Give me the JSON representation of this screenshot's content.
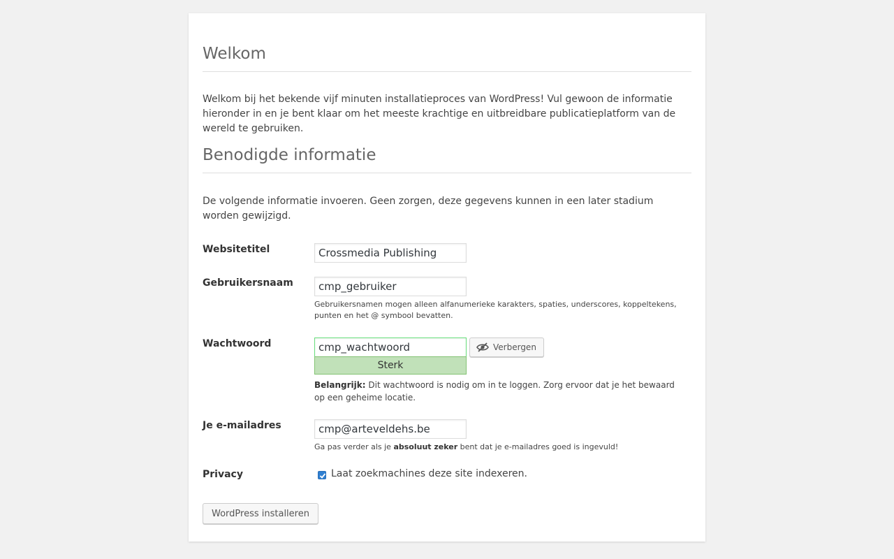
{
  "welcome": {
    "heading": "Welkom",
    "text": "Welkom bij het bekende vijf minuten installatieproces van WordPress! Vul gewoon de informatie hieronder in en je bent klaar om het meeste krachtige en uitbreidbare publicatieplatform van de wereld te gebruiken."
  },
  "info": {
    "heading": "Benodigde informatie",
    "text": "De volgende informatie invoeren. Geen zorgen, deze gegevens kunnen in een later stadium worden gewijzigd."
  },
  "form": {
    "site_title": {
      "label": "Websitetitel",
      "value": "Crossmedia Publishing"
    },
    "username": {
      "label": "Gebruikersnaam",
      "value": "cmp_gebruiker",
      "description": "Gebruikersnamen mogen alleen alfanumerieke karakters, spaties, underscores, koppeltekens, punten en het @ symbool bevatten."
    },
    "password": {
      "label": "Wachtwoord",
      "value": "cmp_wachtwoord",
      "strength": "Sterk",
      "toggle_label": "Verbergen",
      "note_bold": "Belangrijk:",
      "note_text": " Dit wachtwoord is nodig om in te loggen. Zorg ervoor dat je het bewaard op een geheime locatie."
    },
    "email": {
      "label": "Je e-mailadres",
      "value": "cmp@arteveldehs.be",
      "note_pre": "Ga pas verder als je ",
      "note_bold": "absoluut zeker",
      "note_post": " bent dat je e-mailadres goed is ingevuld!"
    },
    "privacy": {
      "label": "Privacy",
      "checkbox_label": "Laat zoekmachines deze site indexeren.",
      "checked": true
    },
    "submit_label": "WordPress installeren"
  },
  "colors": {
    "strength_bg": "#c1e1b9",
    "strength_border": "#83c373",
    "checkbox": "#2f7fd1"
  },
  "icons": {
    "toggle_icon": "eye-slash-icon",
    "checkbox_icon": "checkmark-icon"
  }
}
